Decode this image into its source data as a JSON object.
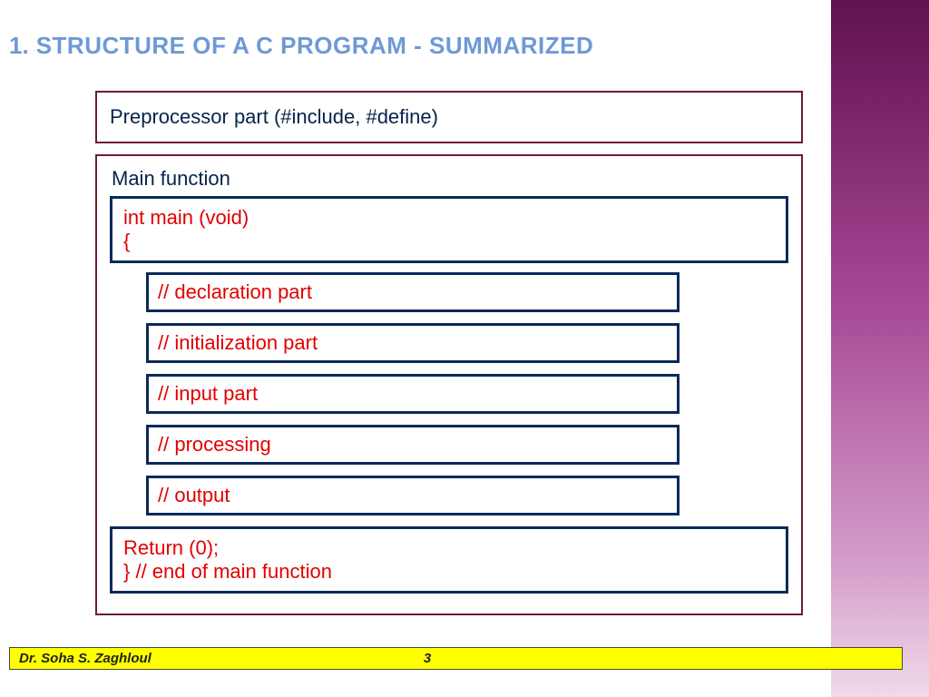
{
  "title": {
    "number": "1.",
    "text": "STRUCTURE OF A C PROGRAM - SUMMARIZED"
  },
  "preprocessor": "Preprocessor part (#include, #define)",
  "main": {
    "label": "Main function",
    "open_line1": "int main (void)",
    "open_line2": "{",
    "parts": [
      "// declaration part",
      "// initialization part",
      "// input part",
      "// processing",
      "// output"
    ],
    "close_line1": "Return (0);",
    "close_line2": "} // end of main function"
  },
  "footer": {
    "author": "Dr. Soha S. Zaghloul",
    "page": "3"
  }
}
